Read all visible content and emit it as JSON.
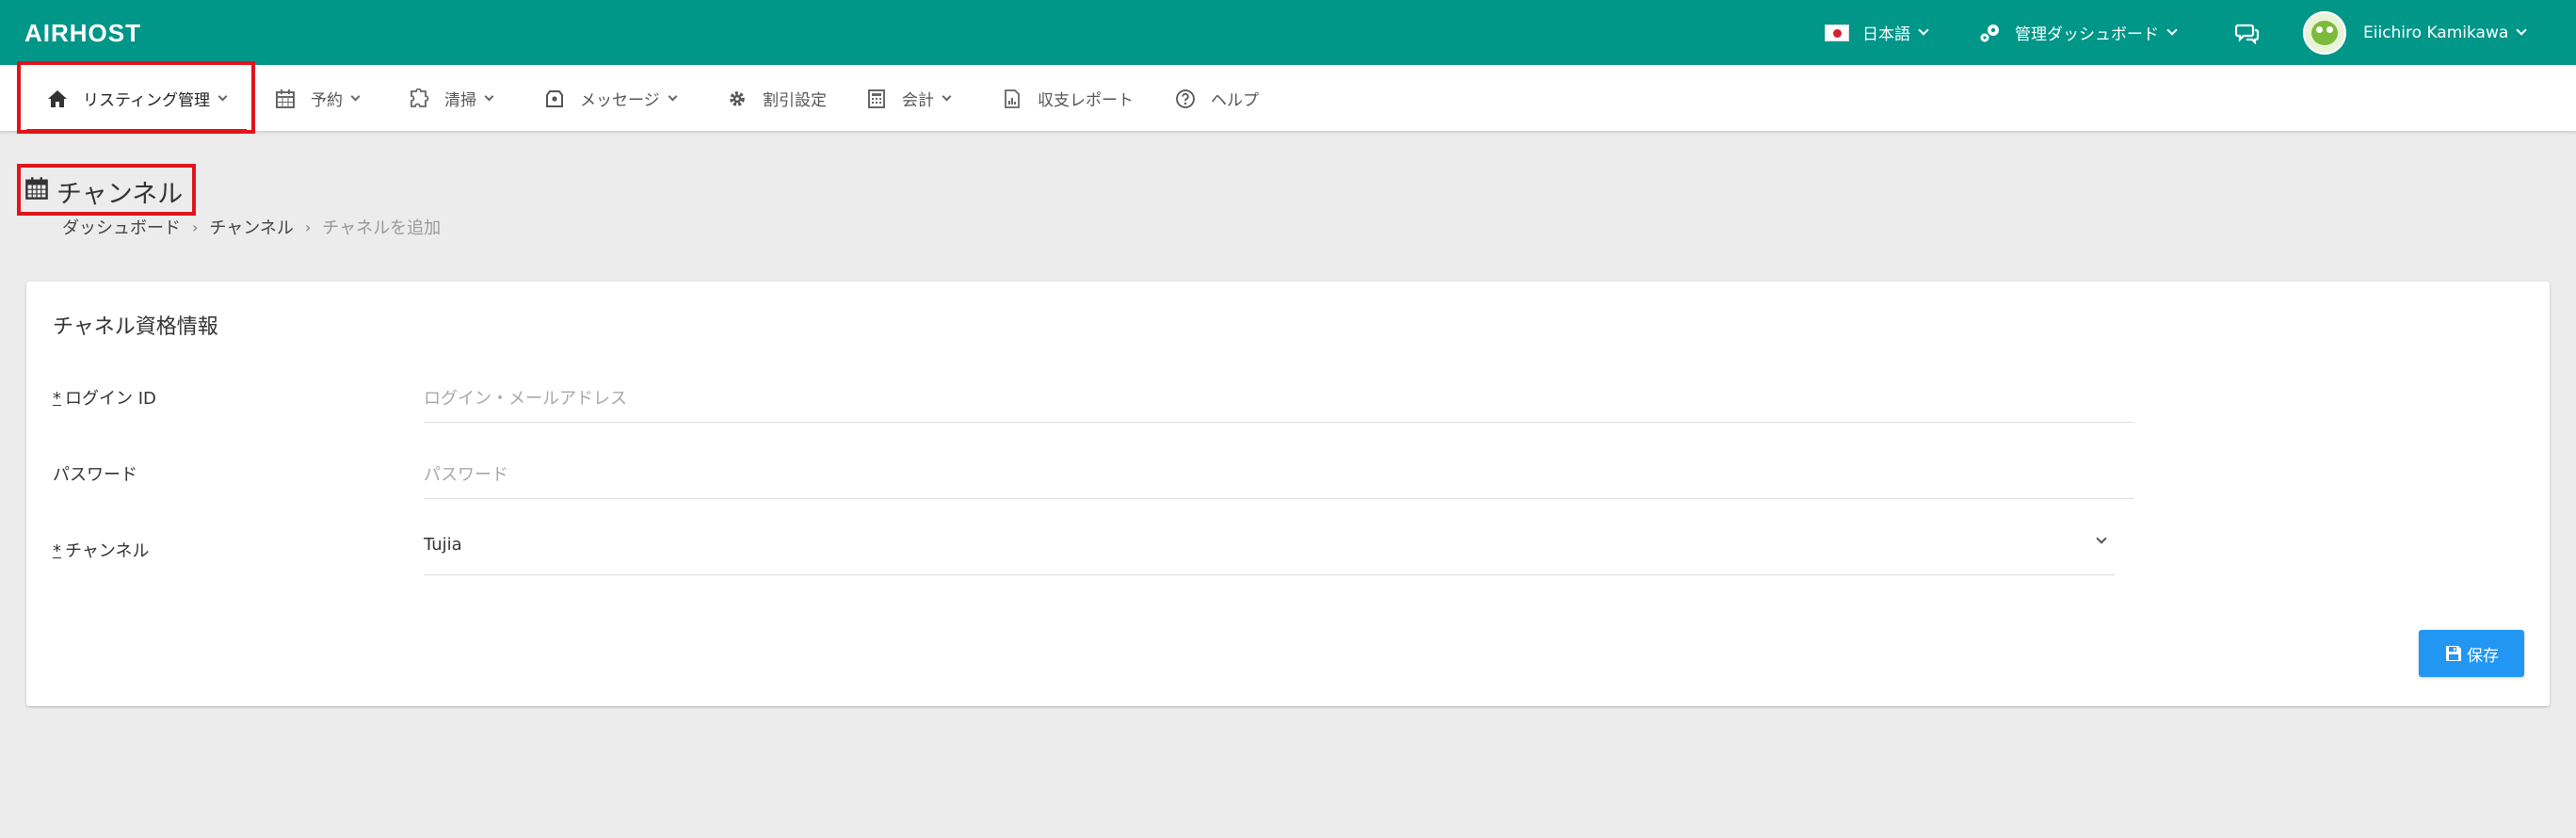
{
  "header": {
    "logo": "AIRHOST",
    "language": "日本語",
    "admin_dashboard": "管理ダッシュボード",
    "user_name": "Eiichiro Kamikawa",
    "brand_color": "#009688"
  },
  "nav": {
    "items": [
      {
        "label": "リスティング管理",
        "icon": "home-icon",
        "has_dropdown": true,
        "active": true
      },
      {
        "label": "予約",
        "icon": "calendar-icon",
        "has_dropdown": true
      },
      {
        "label": "清掃",
        "icon": "puzzle-icon",
        "has_dropdown": true
      },
      {
        "label": "メッセージ",
        "icon": "message-bag-icon",
        "has_dropdown": true
      },
      {
        "label": "割引設定",
        "icon": "gear-icon",
        "has_dropdown": false
      },
      {
        "label": "会計",
        "icon": "calculator-icon",
        "has_dropdown": true
      },
      {
        "label": "収支レポート",
        "icon": "report-icon",
        "has_dropdown": false
      },
      {
        "label": "ヘルプ",
        "icon": "help-icon",
        "has_dropdown": false
      }
    ]
  },
  "page": {
    "title": "チャンネル",
    "breadcrumb": [
      "ダッシュボード",
      "チャンネル",
      "チャネルを追加"
    ]
  },
  "form": {
    "title": "チャネル資格情報",
    "login_label": "ログイン ID",
    "login_placeholder": "ログイン・メールアドレス",
    "password_label": "パスワード",
    "password_placeholder": "パスワード",
    "channel_label": "チャンネル",
    "channel_value": "Tujia",
    "required_mark": "*",
    "save_label": "保存",
    "save_color": "#2196f3"
  },
  "annotations": {
    "highlight_color": "#e1141c"
  }
}
